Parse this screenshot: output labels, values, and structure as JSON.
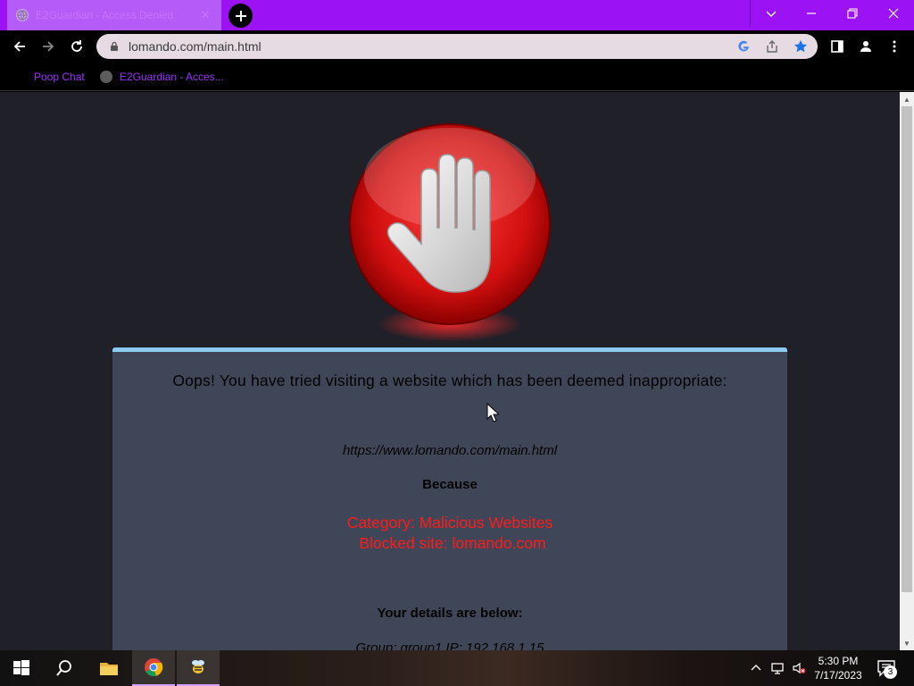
{
  "browser": {
    "tab": {
      "title": "E2Guardian - Access Denied"
    },
    "address_bar": {
      "url": "lomando.com/main.html"
    },
    "bookmarks": [
      {
        "label": "Poop Chat"
      },
      {
        "label": "E2Guardian - Acces..."
      }
    ]
  },
  "page": {
    "warning": "Oops! You have tried visiting a website which has been deemed inappropriate:",
    "blocked_url": "https://www.lomando.com/main.html",
    "because_label": "Because",
    "reason_category": "Category: Malicious Websites",
    "reason_site": "Blocked site: lomando.com",
    "details_heading": "Your details are below:",
    "details_line": "Group: group1   IP: 192.168.1.15"
  },
  "taskbar": {
    "time": "5:30 PM",
    "date": "7/17/2023",
    "notification_count": "3"
  },
  "colors": {
    "accent": "#9b13f5",
    "page_bg": "#1f2028",
    "panel_bg": "#3f4657",
    "panel_border": "#8ccaf0",
    "alert_text": "#ff1b1b"
  }
}
